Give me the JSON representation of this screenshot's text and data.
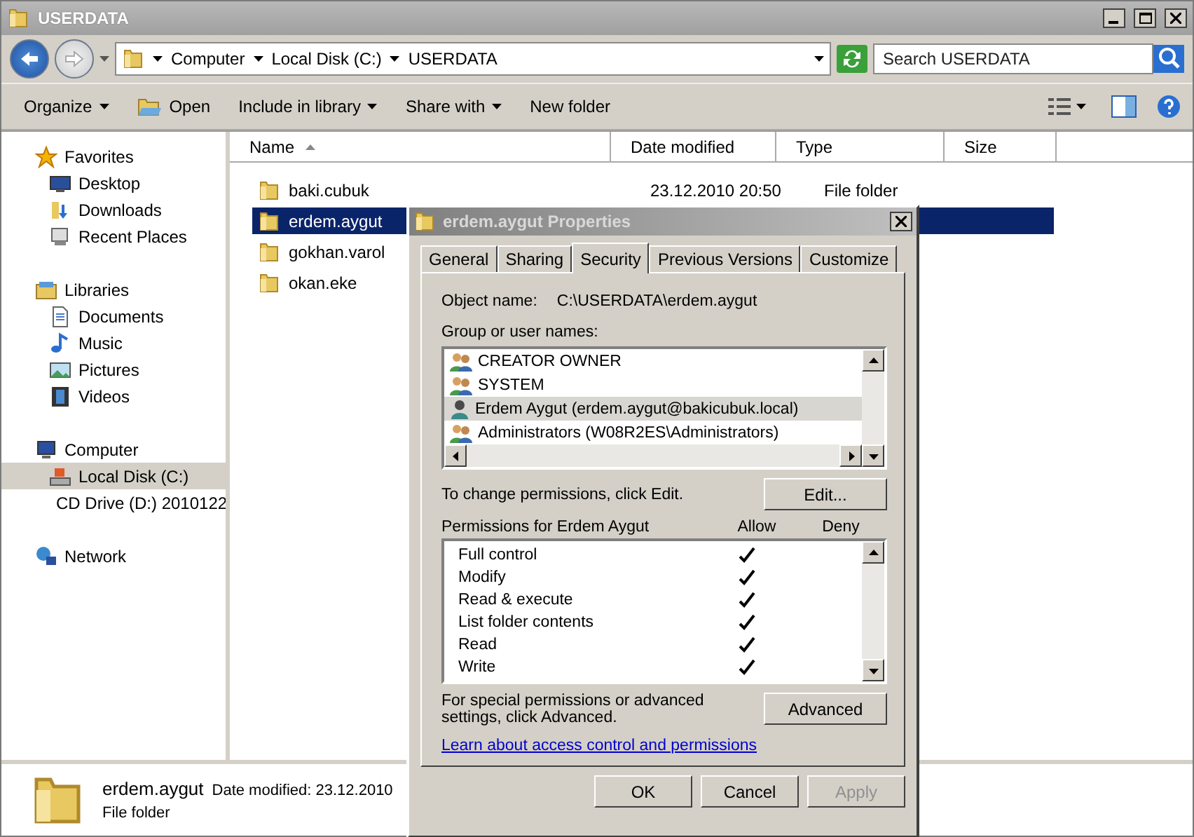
{
  "window": {
    "title": "USERDATA"
  },
  "address": {
    "crumbs": [
      "Computer",
      "Local Disk (C:)",
      "USERDATA"
    ],
    "search": {
      "placeholder": "Search USERDATA"
    }
  },
  "toolbar": [
    {
      "label": "Organize",
      "dropdown": true,
      "kind": "text"
    },
    {
      "label": "Open",
      "dropdown": false,
      "kind": "open"
    },
    {
      "label": "Include in library",
      "dropdown": true,
      "kind": "text"
    },
    {
      "label": "Share with",
      "dropdown": true,
      "kind": "text"
    },
    {
      "label": "New folder",
      "dropdown": false,
      "kind": "text"
    }
  ],
  "nav": [
    {
      "label": "Favorites",
      "kind": "star",
      "selected": false,
      "children": [
        {
          "label": "Desktop",
          "kind": "desktop",
          "selected": false
        },
        {
          "label": "Downloads",
          "kind": "downloads",
          "selected": false
        },
        {
          "label": "Recent Places",
          "kind": "recent",
          "selected": false
        }
      ]
    },
    {
      "label": "Libraries",
      "kind": "library",
      "selected": false,
      "children": [
        {
          "label": "Documents",
          "kind": "documents",
          "selected": false
        },
        {
          "label": "Music",
          "kind": "music",
          "selected": false
        },
        {
          "label": "Pictures",
          "kind": "pictures",
          "selected": false
        },
        {
          "label": "Videos",
          "kind": "videos",
          "selected": false
        }
      ]
    },
    {
      "label": "Computer",
      "kind": "computer",
      "selected": false,
      "children": [
        {
          "label": "Local Disk (C:)",
          "kind": "disk",
          "selected": true
        },
        {
          "label": "CD Drive (D:) 2010122",
          "kind": "cd",
          "selected": false
        }
      ]
    },
    {
      "label": "Network",
      "kind": "network",
      "selected": false
    }
  ],
  "columns": [
    "Name",
    "Date modified",
    "Type",
    "Size"
  ],
  "files": [
    {
      "name": "baki.cubuk",
      "date": "23.12.2010 20:50",
      "type": "File folder",
      "selected": false
    },
    {
      "name": "erdem.aygut",
      "selected": true
    },
    {
      "name": "gokhan.varol",
      "selected": false
    },
    {
      "name": "okan.eke",
      "selected": false
    }
  ],
  "details": {
    "name": "erdem.aygut",
    "meta": "Date modified: 23.12.2010",
    "type": "File folder"
  },
  "dialog": {
    "title": "erdem.aygut Properties",
    "tabs": [
      {
        "label": "General",
        "selected": false
      },
      {
        "label": "Sharing",
        "selected": false
      },
      {
        "label": "Security",
        "selected": true
      },
      {
        "label": "Previous Versions",
        "selected": false
      },
      {
        "label": "Customize",
        "selected": false
      }
    ],
    "object_label": "Object name:",
    "object_value": "C:\\USERDATA\\erdem.aygut",
    "groups_label": "Group or user names:",
    "groups": [
      {
        "name": "CREATOR OWNER",
        "kind": "group",
        "selected": false
      },
      {
        "name": "SYSTEM",
        "kind": "group",
        "selected": false
      },
      {
        "name": "Erdem Aygut (erdem.aygut@bakicubuk.local)",
        "kind": "user",
        "selected": true
      },
      {
        "name": "Administrators (W08R2ES\\Administrators)",
        "kind": "group",
        "selected": false
      }
    ],
    "change_text": "To change permissions, click Edit.",
    "edit_button": "Edit...",
    "perms_label": "Permissions for Erdem Aygut",
    "allow_label": "Allow",
    "deny_label": "Deny",
    "permissions": [
      {
        "name": "Full control",
        "allow": true,
        "deny": false
      },
      {
        "name": "Modify",
        "allow": true,
        "deny": false
      },
      {
        "name": "Read & execute",
        "allow": true,
        "deny": false
      },
      {
        "name": "List folder contents",
        "allow": true,
        "deny": false
      },
      {
        "name": "Read",
        "allow": true,
        "deny": false
      },
      {
        "name": "Write",
        "allow": true,
        "deny": false
      }
    ],
    "special_text": "For special permissions or advanced settings, click Advanced.",
    "advanced_button": "Advanced",
    "link": "Learn about access control and permissions",
    "buttons": [
      {
        "label": "OK",
        "disabled": false
      },
      {
        "label": "Cancel",
        "disabled": false
      },
      {
        "label": "Apply",
        "disabled": true
      }
    ]
  }
}
